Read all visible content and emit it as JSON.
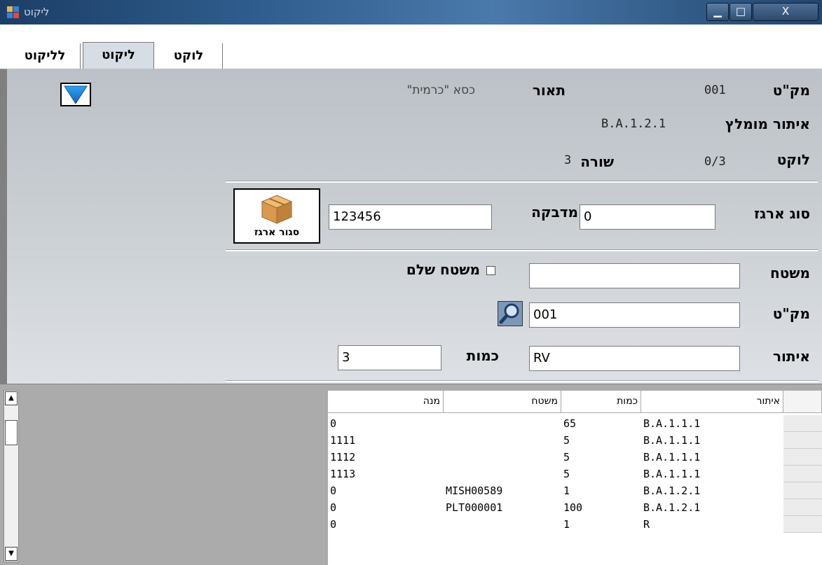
{
  "window": {
    "title": "ליקוט",
    "minimize_label": "▁",
    "maximize_label": "□",
    "close_label": "X"
  },
  "tabs": [
    {
      "label": "לליקוט"
    },
    {
      "label": "ליקוט"
    },
    {
      "label": "לוקט"
    }
  ],
  "form": {
    "item_label": "מק\"ט",
    "item_value": "001",
    "description_label": "תאור",
    "description_value": "\"כסא \"כרמית",
    "recommended_location_label": "איתור מומלץ",
    "recommended_location_value": "B.A.1.2.1",
    "collected_label": "לוקט",
    "collected_value": "0/3",
    "row_label": "שורה",
    "row_value": "3",
    "box_type_label": "סוג ארגז",
    "box_type_value": "0",
    "sticker_label": "מדבקה",
    "sticker_value": "123456",
    "close_box_label": "סגור ארגז",
    "pallet_label": "משטח",
    "pallet_value": "",
    "full_pallet_label": "משטח שלם",
    "full_pallet_checked": false,
    "item_input_label": "מק\"ט",
    "item_input_value": "001",
    "location_label": "איתור",
    "location_value": "RV",
    "quantity_label": "כמות",
    "quantity_value": "3"
  },
  "grid": {
    "columns": [
      "איתור",
      "כמות",
      "משטח",
      "מנה"
    ],
    "rows": [
      {
        "location": "B.A.1.1.1",
        "qty": "65",
        "pallet": "",
        "lot": "0"
      },
      {
        "location": "B.A.1.1.1",
        "qty": "5",
        "pallet": "",
        "lot": "1111"
      },
      {
        "location": "B.A.1.1.1",
        "qty": "5",
        "pallet": "",
        "lot": "1112"
      },
      {
        "location": "B.A.1.1.1",
        "qty": "5",
        "pallet": "",
        "lot": "1113"
      },
      {
        "location": "B.A.1.2.1",
        "qty": "1",
        "pallet": "MISH00589",
        "lot": "0"
      },
      {
        "location": "B.A.1.2.1",
        "qty": "100",
        "pallet": "PLT000001",
        "lot": "0"
      },
      {
        "location": "R",
        "qty": "1",
        "pallet": "",
        "lot": "0"
      }
    ]
  },
  "scrollbar": {
    "up_arrow": "▲",
    "down_arrow": "▼"
  },
  "colors": {
    "title_bar": "#2e5c8c",
    "panel": "#c9ced3",
    "dropdown_arrow": "#2a8ee0",
    "box_icon": "#d99a4e"
  },
  "icons": {
    "dropdown": "triangle-down-icon",
    "close_box": "cardboard-box-icon",
    "search": "magnifier-icon",
    "app": "window-app-icon"
  }
}
